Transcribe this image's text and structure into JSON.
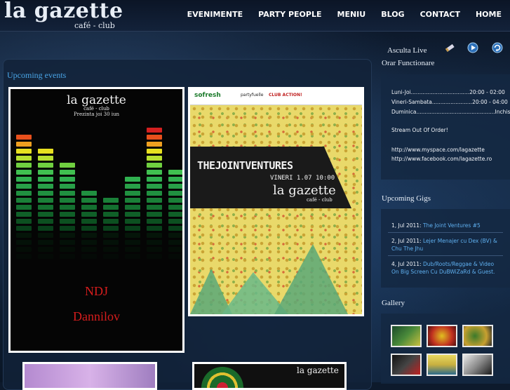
{
  "header": {
    "logo_main": "la gazette",
    "logo_sub": "café - club",
    "nav": [
      "EVENIMENTE",
      "PARTY PEOPLE",
      "MENIU",
      "BLOG",
      "CONTACT",
      "HOME"
    ]
  },
  "main": {
    "section_title": "Upcoming events",
    "poster1": {
      "logo": "la gazette",
      "logo_sub": "café - club",
      "presents": "Prezinta joi 30 iun",
      "line1": "NDJ",
      "line2": "Dannilov"
    },
    "poster2": {
      "sponsor": "sofresh",
      "tag1": "partyfuelle",
      "tag2": "CLUB ACTION!",
      "title": "THEJOINTVENTURES",
      "date": "VINERI 1.07 10:00",
      "logo": "la gazette",
      "logo_sub": "café - club"
    },
    "poster4": {
      "logo": "la gazette"
    }
  },
  "sidebar": {
    "listen_label": "Asculta Live",
    "hours_title": "Orar Functionare",
    "hours": [
      "Luni-Joi...................................20:00 - 02:00",
      "Vineri-Sambata........................20:00 - 04:00",
      "Duminica...............................................Inchis"
    ],
    "stream_status": "Stream Out Of Order!",
    "links": [
      "http://www.myspace.com/lagazette",
      "http://www.facebook.com/lagazette.ro"
    ],
    "gigs_title": "Upcoming Gigs",
    "gigs": [
      {
        "date": "1, Jul 2011:",
        "title": "The Joint Ventures #5"
      },
      {
        "date": "2, Jul 2011:",
        "title": "Lejer Menajer cu Dex (BV) & Chu The Jhu"
      },
      {
        "date": "4, Jul 2011:",
        "title": "Dub/Roots/Reggae & Video On Big Screen Cu DuBWiZaRd & Guest."
      }
    ],
    "gallery_title": "Gallery"
  }
}
